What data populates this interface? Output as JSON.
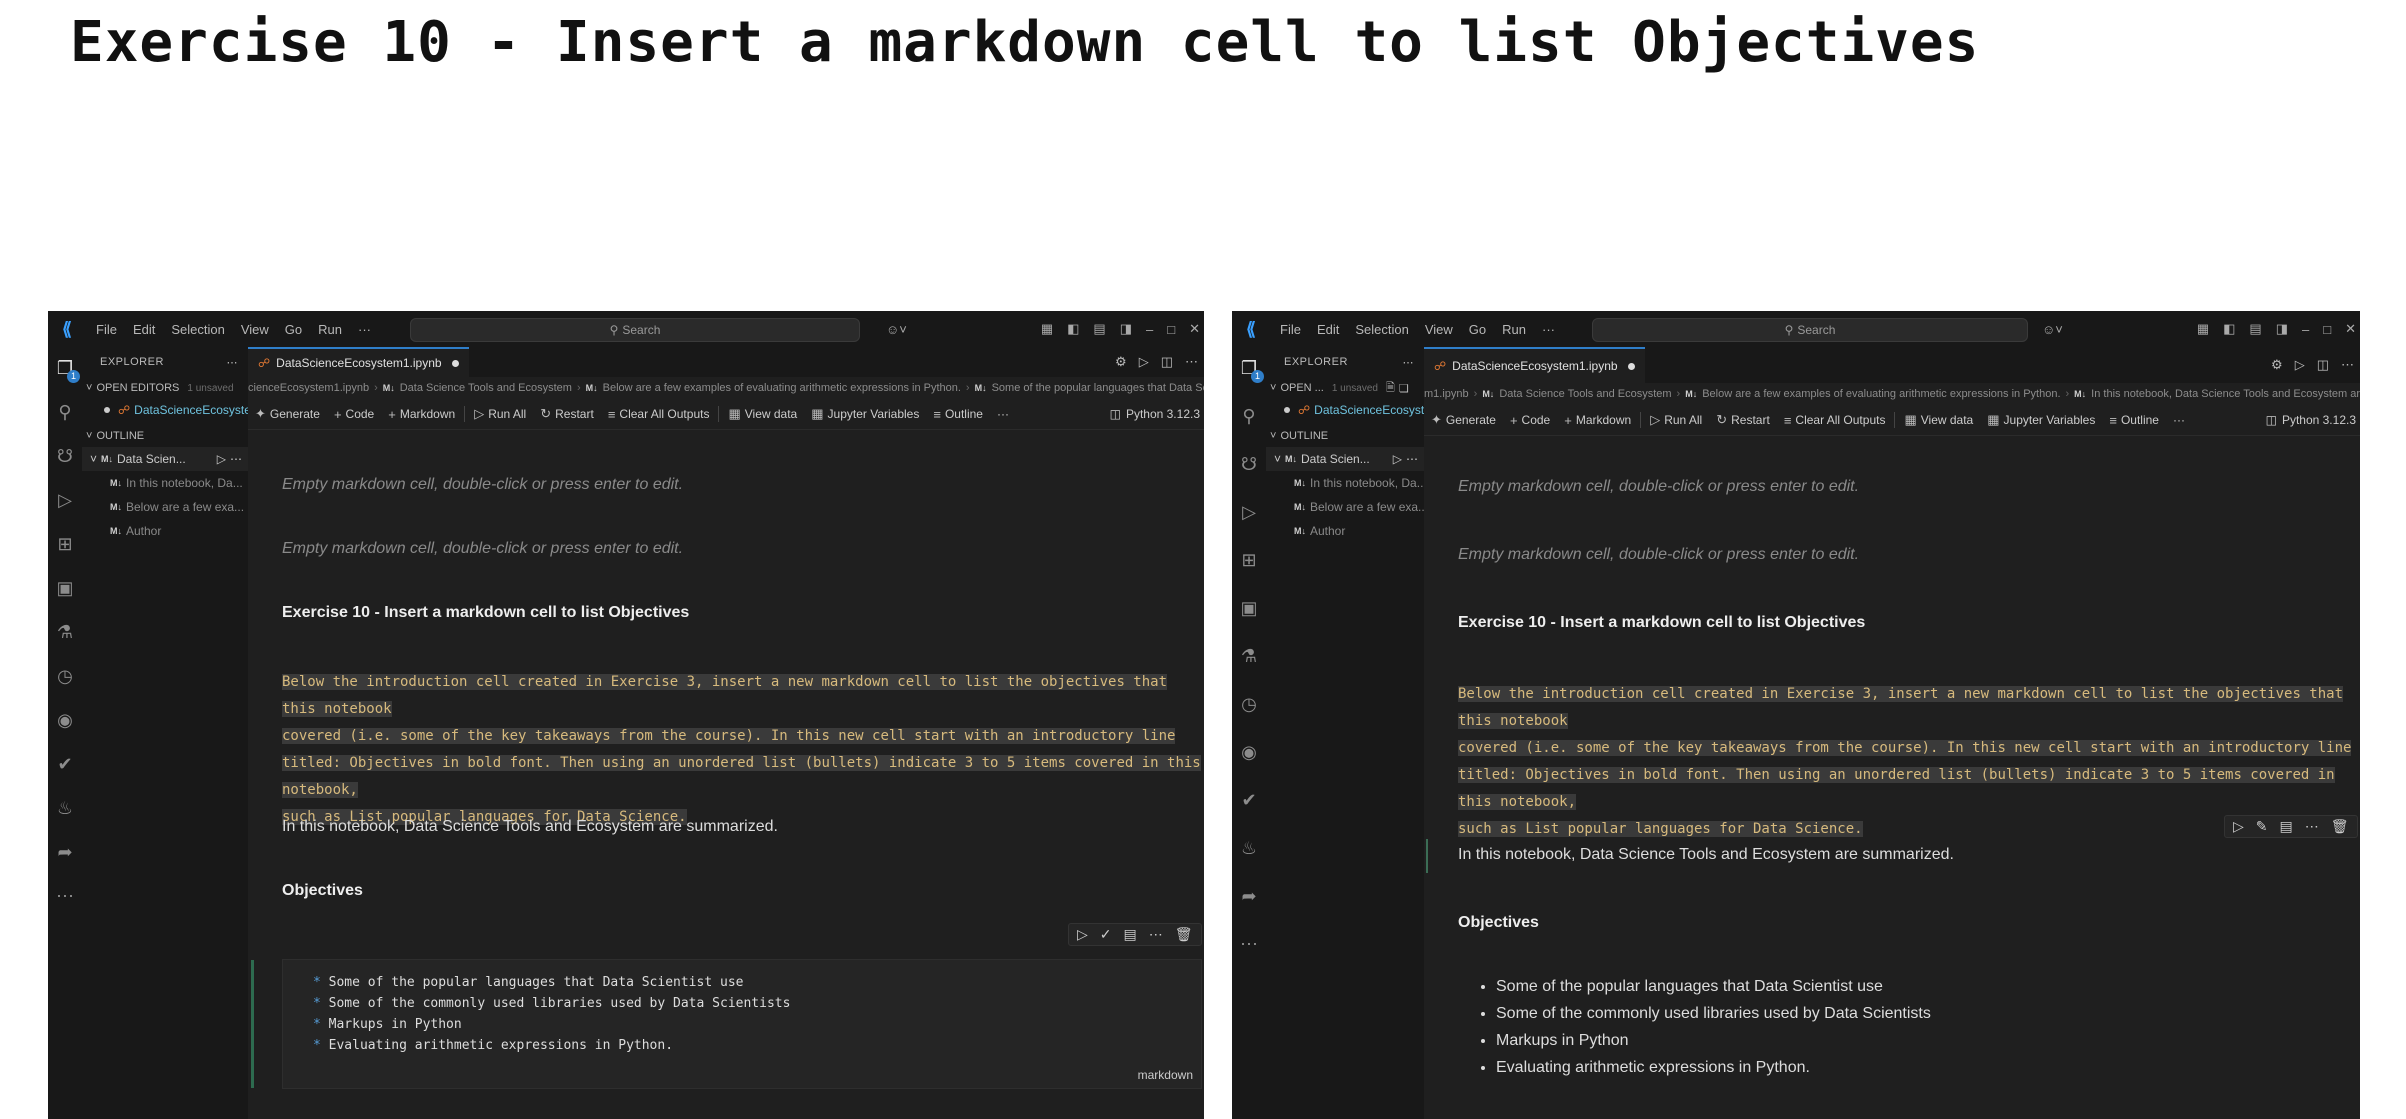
{
  "slide": {
    "title": "Exercise 10 - Insert a markdown cell to list Objectives"
  },
  "vscode": {
    "menu": [
      "File",
      "Edit",
      "Selection",
      "View",
      "Go",
      "Run",
      "···"
    ],
    "search_label": "Search",
    "explorer_title": "EXPLORER",
    "open_editors_label": "OPEN EDITORS",
    "open_editors_label_short": "OPEN ...",
    "unsaved_label": "1 unsaved",
    "open_file_name": "DataScienceEcosyste...",
    "open_file_name_short": "DataScienceEcosyste...",
    "outline_label": "OUTLINE",
    "outline_root": "Data Scien...",
    "outline_items": [
      "In this notebook, Da...",
      "Below are a few exa...",
      "Author"
    ],
    "tab_file": "DataScienceEcosystem1.ipynb",
    "breadcrumb_left": [
      "cienceEcosystem1.ipynb",
      "Data Science Tools and Ecosystem",
      "Below are a few examples of evaluating arithmetic expressions in Python.",
      "Some of the popular languages that Data Scientist use"
    ],
    "breadcrumb_right": [
      "m1.ipynb",
      "Data Science Tools and Ecosystem",
      "Below are a few examples of evaluating arithmetic expressions in Python.",
      "In this notebook, Data Science Tools and Ecosystem are summarized."
    ],
    "toolbar": {
      "generate": "Generate",
      "code": "Code",
      "markdown": "Markdown",
      "run_all": "Run All",
      "restart": "Restart",
      "clear_outputs": "Clear All Outputs",
      "view_data": "View data",
      "jupyter_variables": "Jupyter Variables",
      "outline": "Outline",
      "more": "···"
    },
    "kernel": "Python 3.12.3",
    "md_badge": "M↓"
  },
  "notebook": {
    "empty_cell": "Empty markdown cell, double-click or press enter to edit.",
    "exercise_heading": "Exercise 10 - Insert a markdown cell to list Objectives",
    "instruction_lines": [
      "Below the introduction cell created in Exercise 3, insert a new markdown cell to list the objectives that this notebook",
      "covered (i.e. some of the key takeaways from the course). In this new cell start with an introductory line",
      "titled: Objectives in bold font. Then using an unordered list (bullets) indicate 3 to 5 items covered in this notebook,",
      "such as List popular languages for Data Science."
    ],
    "intro_text": "In this notebook, Data Science Tools and Ecosystem are summarized.",
    "objectives_heading": "Objectives",
    "objective_items": [
      "Some of the popular languages that Data Scientist use",
      "Some of the commonly used libraries used by Data Scientists",
      "Markups in Python",
      "Evaluating arithmetic expressions in Python."
    ],
    "bullet_char": "*",
    "cell_language": "markdown"
  }
}
